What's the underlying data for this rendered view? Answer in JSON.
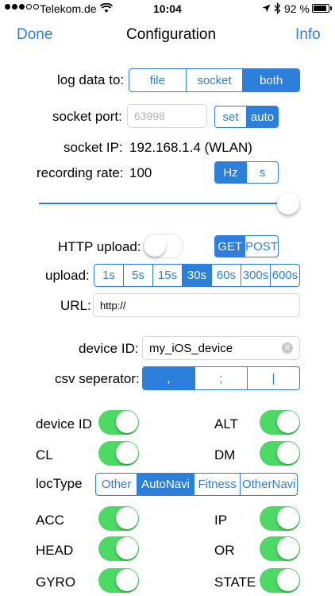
{
  "status_bar": {
    "carrier": "Telekom.de",
    "time": "10:04",
    "battery": "92 %"
  },
  "nav": {
    "left": "Done",
    "title": "Configuration",
    "right": "Info"
  },
  "log_data": {
    "label": "log data to:",
    "options": [
      "file",
      "socket",
      "both"
    ],
    "selected": "both"
  },
  "socket_port": {
    "label": "socket port:",
    "placeholder": "63998",
    "options": [
      "set",
      "auto"
    ],
    "selected": "auto"
  },
  "socket_ip": {
    "label": "socket IP:",
    "value": "192.168.1.4 (WLAN)"
  },
  "recording_rate": {
    "label": "recording rate:",
    "value": "100",
    "options": [
      "Hz",
      "s"
    ],
    "selected": "Hz",
    "slider_fraction": 0.99
  },
  "http_upload": {
    "label": "HTTP upload:",
    "enabled": false,
    "methods": [
      "GET",
      "POST"
    ],
    "selected_method": "GET"
  },
  "upload": {
    "label": "upload:",
    "options": [
      "1s",
      "5s",
      "15s",
      "30s",
      "60s",
      "300s",
      "600s"
    ],
    "selected": "30s"
  },
  "url": {
    "label": "URL:",
    "value": "http://"
  },
  "device_id": {
    "label": "device ID:",
    "value": "my_iOS_device"
  },
  "csv_separator": {
    "label": "csv seperator:",
    "options": [
      ",",
      ";",
      "|"
    ],
    "selected": ","
  },
  "toggles": {
    "device_id": {
      "label": "device ID",
      "on": true
    },
    "alt": {
      "label": "ALT",
      "on": true
    },
    "cl": {
      "label": "CL",
      "on": true
    },
    "dm": {
      "label": "DM",
      "on": true
    },
    "acc": {
      "label": "ACC",
      "on": true
    },
    "ip": {
      "label": "IP",
      "on": true
    },
    "head": {
      "label": "HEAD",
      "on": true
    },
    "or": {
      "label": "OR",
      "on": true
    },
    "gyro": {
      "label": "GYRO",
      "on": true
    },
    "state": {
      "label": "STATE",
      "on": true
    }
  },
  "loc_type": {
    "label": "locType",
    "options": [
      "Other",
      "AutoNavi",
      "Fitness",
      "OtherNavi"
    ],
    "selected": "AutoNavi"
  },
  "colors": {
    "accent": "#2d7fdc",
    "switch_on": "#4cd964"
  }
}
